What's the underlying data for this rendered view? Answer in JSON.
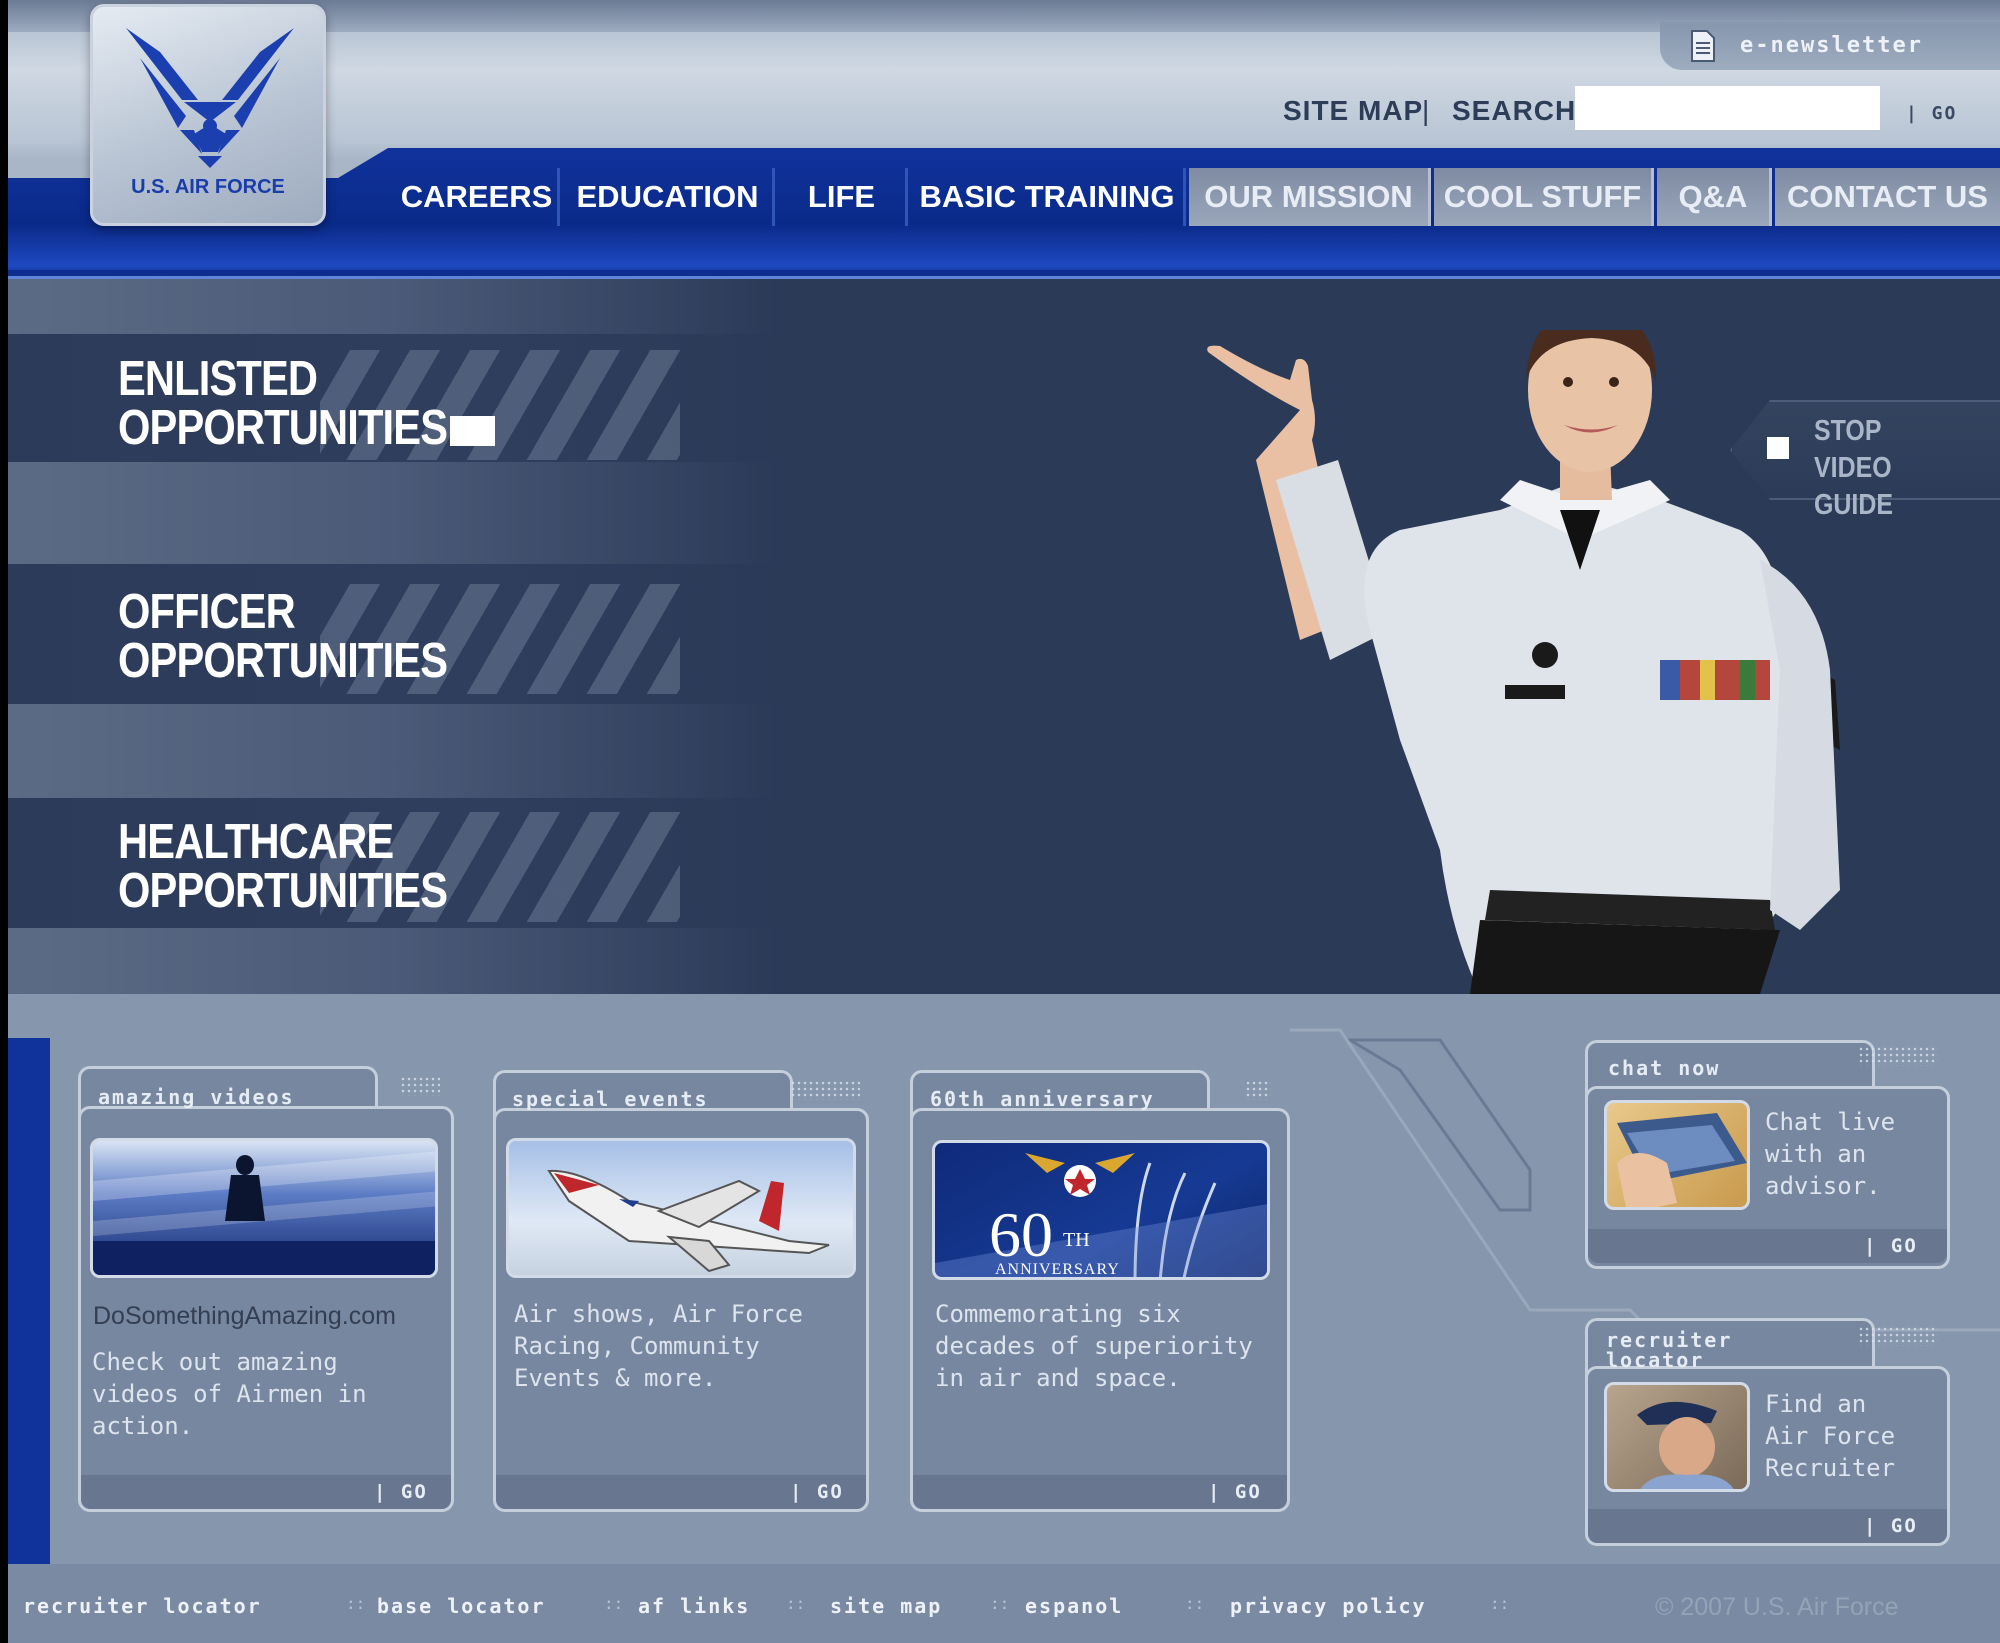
{
  "header": {
    "logo_text": "U.S. AIR FORCE",
    "newsletter": "e-newsletter",
    "site_map": "SITE MAP",
    "separator": "|",
    "search_label": "SEARCH",
    "search_placeholder": "",
    "go": "| GO"
  },
  "nav": {
    "items": [
      {
        "label": "CAREERS"
      },
      {
        "label": "EDUCATION"
      },
      {
        "label": "LIFE"
      },
      {
        "label": "BASIC TRAINING"
      },
      {
        "label": "OUR MISSION"
      },
      {
        "label": "COOL STUFF"
      },
      {
        "label": "Q&A"
      },
      {
        "label": "CONTACT US"
      }
    ]
  },
  "hero": {
    "enlisted": {
      "line1": "ENLISTED",
      "line2": "OPPORTUNITIES"
    },
    "officer": {
      "line1": "OFFICER",
      "line2": "OPPORTUNITIES"
    },
    "healthcare": {
      "line1": "HEALTHCARE",
      "line2": "OPPORTUNITIES"
    },
    "stop_video": {
      "line1": "STOP",
      "line2": "VIDEO GUIDE"
    }
  },
  "cards": {
    "amazing": {
      "title": "amazing videos",
      "link": "DoSomethingAmazing.com",
      "body": [
        "Check out amazing",
        "videos of Airmen in",
        "action."
      ],
      "go": "| GO"
    },
    "events": {
      "title": "special events",
      "body": [
        "Air shows, Air Force",
        "Racing, Community",
        "Events & more."
      ],
      "go": "| GO"
    },
    "anniversary": {
      "title": "60th anniversary",
      "thumb_number": "60",
      "thumb_suffix": "TH",
      "thumb_label": "ANNIVERSARY",
      "body": [
        "Commemorating six",
        "decades of superiority",
        "in air and space."
      ],
      "go": "| GO"
    },
    "chat": {
      "title": "chat now",
      "body": [
        "Chat live",
        "with an",
        "advisor."
      ],
      "go": "| GO"
    },
    "recruiter": {
      "title_line1": "recruiter",
      "title_line2": "locator",
      "body": [
        "Find an",
        "Air Force",
        "Recruiter"
      ],
      "go": "| GO"
    }
  },
  "footer": {
    "links": [
      "recruiter locator",
      "base locator",
      "af links",
      "site map",
      "espanol",
      "privacy policy"
    ],
    "separator": "::",
    "copyright": "© 2007 U.S. Air Force"
  },
  "colors": {
    "nav_blue": "#10329b",
    "hero_bg": "#2a3a57",
    "panel_bg": "#8696ad"
  }
}
